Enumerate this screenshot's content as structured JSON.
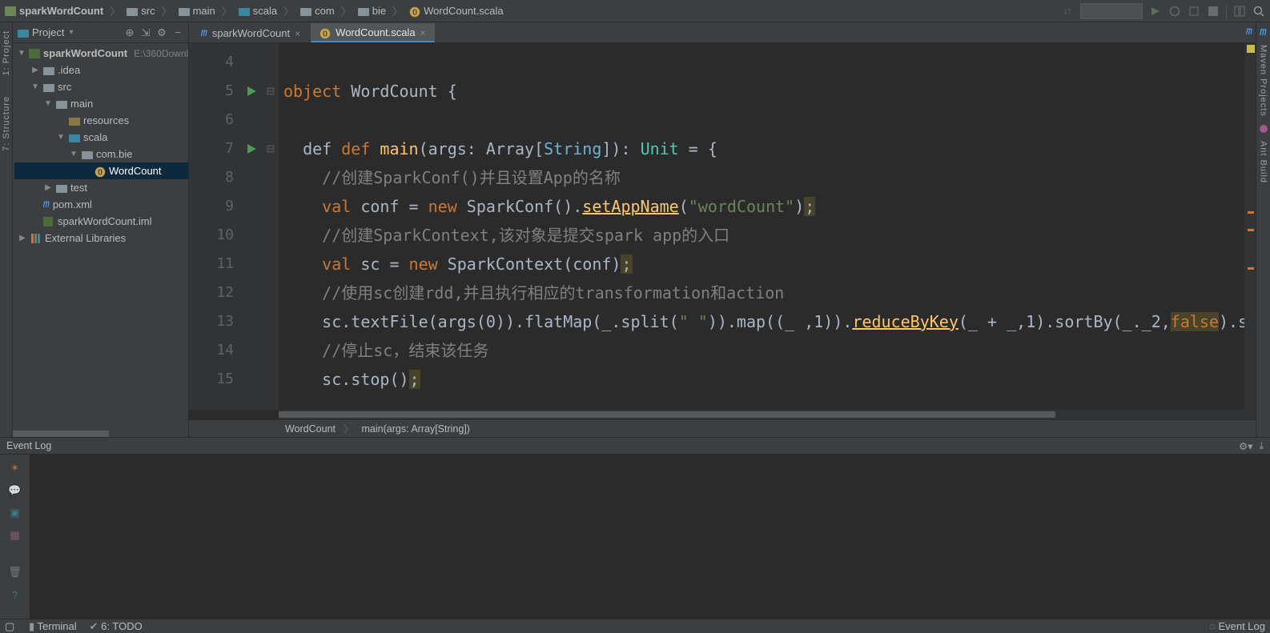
{
  "breadcrumbs": {
    "root": "sparkWordCount",
    "p1": "src",
    "p2": "main",
    "p3": "scala",
    "p4": "com",
    "p5": "bie",
    "file": "WordCount.scala"
  },
  "toolwindows": {
    "left1": "1: Project",
    "left2": "7: Structure",
    "right_m": "m",
    "right1": "Maven Projects",
    "right2": "Ant Build"
  },
  "projectPanel": {
    "title": "Project",
    "root": "sparkWordCount",
    "rootPath": "E:\\360Downl",
    "idea": ".idea",
    "src": "src",
    "main": "main",
    "resources": "resources",
    "scala": "scala",
    "pkg": "com.bie",
    "wordcount": "WordCount",
    "test": "test",
    "pom": "pom.xml",
    "iml": "sparkWordCount.iml",
    "ext": "External Libraries"
  },
  "tabs": {
    "t1": "sparkWordCount",
    "t2": "WordCount.scala"
  },
  "code": {
    "lines": [
      "4",
      "5",
      "6",
      "7",
      "8",
      "9",
      "10",
      "11",
      "12",
      "13",
      "14",
      "15"
    ],
    "l5_kw": "object",
    "l5_name": " WordCount {",
    "l7_def": "  def ",
    "l7_main": "main",
    "l7_sig1": "(args: Array[",
    "l7_string": "String",
    "l7_sig2": "]): ",
    "l7_unit": "Unit",
    "l7_sig3": " = {",
    "l8_cmt": "    //创建SparkConf()并且设置App的名称",
    "l9_a": "    ",
    "l9_val": "val",
    "l9_b": " conf = ",
    "l9_new": "new",
    "l9_c": " SparkConf().",
    "l9_fn": "setAppName",
    "l9_d": "(",
    "l9_str": "\"wordCount\"",
    "l9_e": ")",
    "l10_cmt": "    //创建SparkContext,该对象是提交spark app的入口",
    "l11_a": "    ",
    "l11_val": "val",
    "l11_b": " sc = ",
    "l11_new": "new",
    "l11_c": " SparkContext(conf)",
    "l12_cmt": "    //使用sc创建rdd,并且执行相应的transformation和action",
    "l13_a": "    sc.textFile(args(0)).flatMap(_.split(",
    "l13_str": "\" \"",
    "l13_b": ")).map((_ ,1)).",
    "l13_fn": "reduceByKey",
    "l13_c": "(_ + _,1).sortBy(_._2,",
    "l13_false": "false",
    "l13_d": ").sav",
    "l14_cmt": "    //停止sc，结束该任务",
    "l15_a": "    sc.stop()"
  },
  "editorBreadcrumb": {
    "a": "WordCount",
    "b": "main(args: Array[String])"
  },
  "eventlog": {
    "title": "Event Log"
  },
  "status": {
    "terminal": "Terminal",
    "todo": "6: TODO",
    "evlog": "Event Log"
  }
}
